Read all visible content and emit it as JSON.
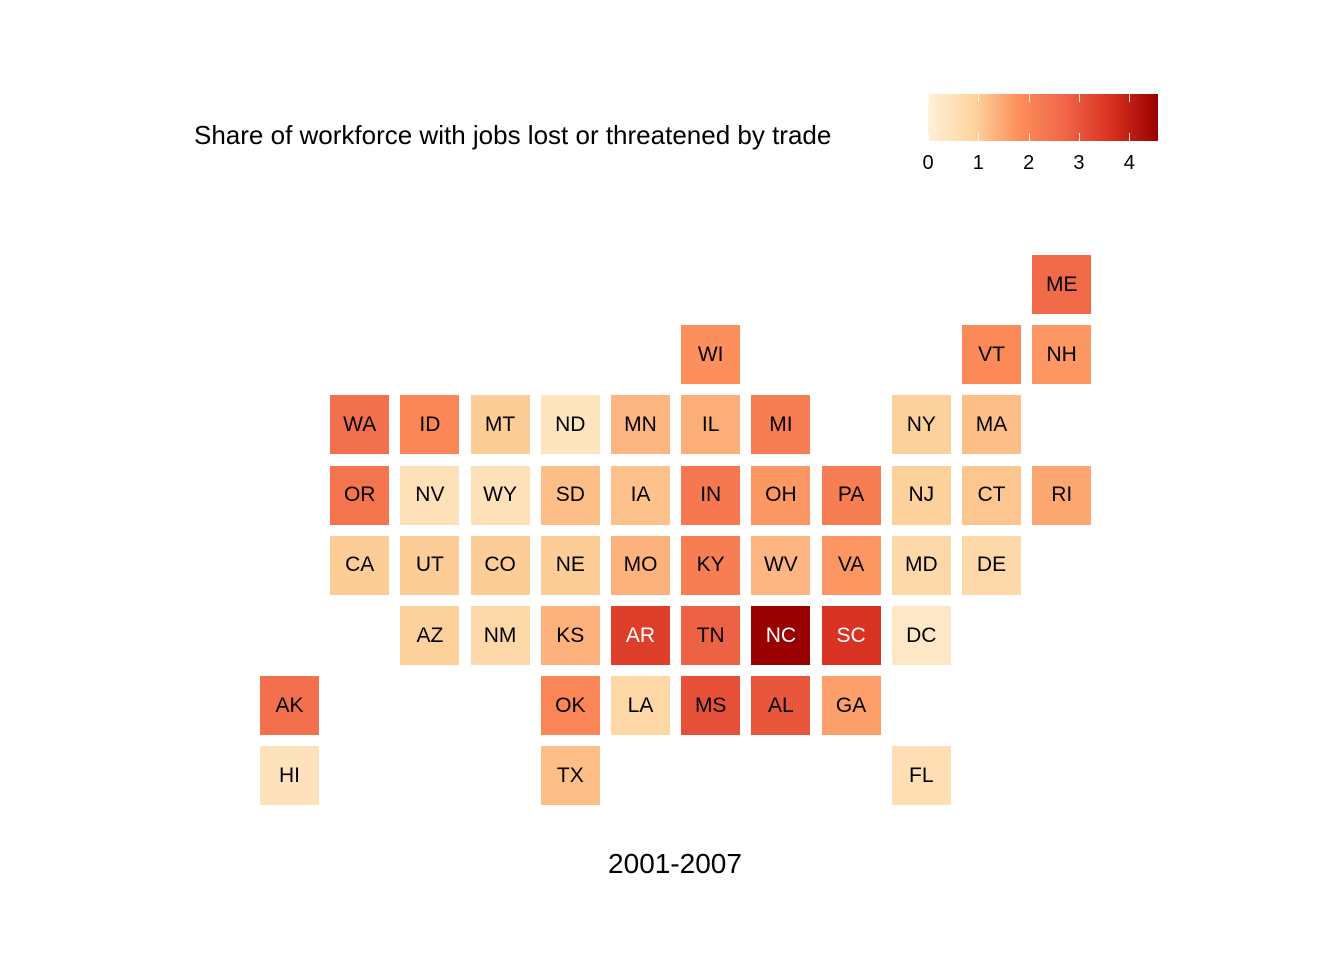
{
  "chart_data": {
    "type": "heatmap",
    "subtype": "state-tile-grid-map",
    "legend": {
      "title": "Share of workforce with jobs lost or threatened by trade",
      "ticks": [
        0,
        1,
        2,
        3,
        4
      ],
      "range": [
        0,
        4.57
      ],
      "colors": [
        "#fff0d9",
        "#fdd49e",
        "#fc8d59",
        "#ef6548",
        "#d7301f",
        "#990000"
      ],
      "placement": "top"
    },
    "caption": "2001-2007",
    "tiles": [
      {
        "state": "ME",
        "row": 0,
        "col": 11,
        "value": 2.6
      },
      {
        "state": "WI",
        "row": 1,
        "col": 6,
        "value": 1.8
      },
      {
        "state": "VT",
        "row": 1,
        "col": 10,
        "value": 1.9
      },
      {
        "state": "NH",
        "row": 1,
        "col": 11,
        "value": 1.7
      },
      {
        "state": "WA",
        "row": 2,
        "col": 1,
        "value": 2.5
      },
      {
        "state": "ID",
        "row": 2,
        "col": 2,
        "value": 2.0
      },
      {
        "state": "MT",
        "row": 2,
        "col": 3,
        "value": 1.0
      },
      {
        "state": "ND",
        "row": 2,
        "col": 4,
        "value": 0.4
      },
      {
        "state": "MN",
        "row": 2,
        "col": 5,
        "value": 1.3
      },
      {
        "state": "IL",
        "row": 2,
        "col": 6,
        "value": 1.4
      },
      {
        "state": "MI",
        "row": 2,
        "col": 7,
        "value": 2.2
      },
      {
        "state": "NY",
        "row": 2,
        "col": 9,
        "value": 0.95
      },
      {
        "state": "MA",
        "row": 2,
        "col": 10,
        "value": 1.2
      },
      {
        "state": "OR",
        "row": 3,
        "col": 1,
        "value": 2.4
      },
      {
        "state": "NV",
        "row": 3,
        "col": 2,
        "value": 0.5
      },
      {
        "state": "WY",
        "row": 3,
        "col": 3,
        "value": 0.5
      },
      {
        "state": "SD",
        "row": 3,
        "col": 4,
        "value": 1.2
      },
      {
        "state": "IA",
        "row": 3,
        "col": 5,
        "value": 1.15
      },
      {
        "state": "IN",
        "row": 3,
        "col": 6,
        "value": 2.3
      },
      {
        "state": "OH",
        "row": 3,
        "col": 7,
        "value": 1.7
      },
      {
        "state": "PA",
        "row": 3,
        "col": 8,
        "value": 2.2
      },
      {
        "state": "NJ",
        "row": 3,
        "col": 9,
        "value": 0.95
      },
      {
        "state": "CT",
        "row": 3,
        "col": 10,
        "value": 1.1
      },
      {
        "state": "RI",
        "row": 3,
        "col": 11,
        "value": 1.5
      },
      {
        "state": "CA",
        "row": 4,
        "col": 1,
        "value": 1.0
      },
      {
        "state": "UT",
        "row": 4,
        "col": 2,
        "value": 1.0
      },
      {
        "state": "CO",
        "row": 4,
        "col": 3,
        "value": 1.0
      },
      {
        "state": "NE",
        "row": 4,
        "col": 4,
        "value": 1.0
      },
      {
        "state": "MO",
        "row": 4,
        "col": 5,
        "value": 1.35
      },
      {
        "state": "KY",
        "row": 4,
        "col": 6,
        "value": 2.2
      },
      {
        "state": "WV",
        "row": 4,
        "col": 7,
        "value": 1.3
      },
      {
        "state": "VA",
        "row": 4,
        "col": 8,
        "value": 1.7
      },
      {
        "state": "MD",
        "row": 4,
        "col": 9,
        "value": 0.75
      },
      {
        "state": "DE",
        "row": 4,
        "col": 10,
        "value": 0.75
      },
      {
        "state": "AZ",
        "row": 5,
        "col": 2,
        "value": 0.95
      },
      {
        "state": "NM",
        "row": 5,
        "col": 3,
        "value": 0.75
      },
      {
        "state": "KS",
        "row": 5,
        "col": 4,
        "value": 1.35
      },
      {
        "state": "AR",
        "row": 5,
        "col": 5,
        "value": 3.4
      },
      {
        "state": "TN",
        "row": 5,
        "col": 6,
        "value": 2.8
      },
      {
        "state": "NC",
        "row": 5,
        "col": 7,
        "value": 4.57
      },
      {
        "state": "SC",
        "row": 5,
        "col": 8,
        "value": 3.6
      },
      {
        "state": "DC",
        "row": 5,
        "col": 9,
        "value": 0.3
      },
      {
        "state": "AK",
        "row": 6,
        "col": 0,
        "value": 2.5
      },
      {
        "state": "OK",
        "row": 6,
        "col": 4,
        "value": 2.0
      },
      {
        "state": "LA",
        "row": 6,
        "col": 5,
        "value": 0.8
      },
      {
        "state": "MS",
        "row": 6,
        "col": 6,
        "value": 3.1
      },
      {
        "state": "AL",
        "row": 6,
        "col": 7,
        "value": 3.0
      },
      {
        "state": "GA",
        "row": 6,
        "col": 8,
        "value": 1.6
      },
      {
        "state": "HI",
        "row": 7,
        "col": 0,
        "value": 0.45
      },
      {
        "state": "TX",
        "row": 7,
        "col": 4,
        "value": 1.2
      },
      {
        "state": "FL",
        "row": 7,
        "col": 9,
        "value": 0.6
      }
    ]
  }
}
